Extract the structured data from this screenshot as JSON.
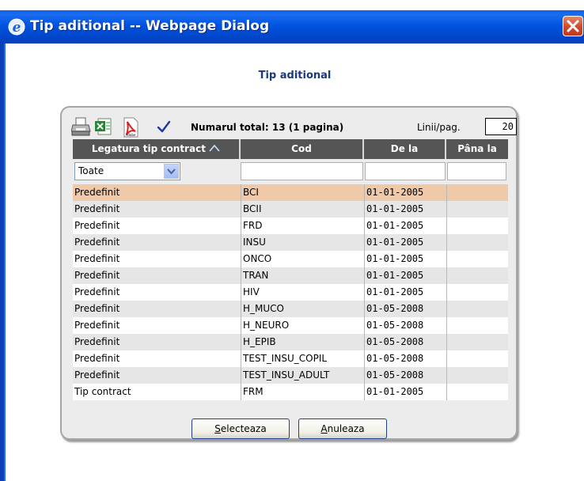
{
  "window": {
    "title": "Tip aditional -- Webpage Dialog",
    "title_icon": "ie-icon",
    "close_icon": "close-icon"
  },
  "dialog": {
    "heading": "Tip aditional"
  },
  "toolbar": {
    "icons": [
      "print-icon",
      "excel-icon",
      "pdf-icon",
      "checkmark-icon"
    ],
    "total_text": "Numarul total: 13 (1 pagina)",
    "lines_label": "Linii/pag.",
    "lines_value": "20"
  },
  "grid": {
    "columns": [
      "Legatura tip contract",
      "Cod",
      "De la",
      "Pâna la"
    ],
    "sort_indicator": "sort-up-icon",
    "filter": {
      "selected": "Toate"
    },
    "rows": [
      {
        "legatura": "Predefinit",
        "cod": "BCI",
        "de_la": "01-01-2005",
        "pana_la": ""
      },
      {
        "legatura": "Predefinit",
        "cod": "BCII",
        "de_la": "01-01-2005",
        "pana_la": ""
      },
      {
        "legatura": "Predefinit",
        "cod": "FRD",
        "de_la": "01-01-2005",
        "pana_la": ""
      },
      {
        "legatura": "Predefinit",
        "cod": "INSU",
        "de_la": "01-01-2005",
        "pana_la": ""
      },
      {
        "legatura": "Predefinit",
        "cod": "ONCO",
        "de_la": "01-01-2005",
        "pana_la": ""
      },
      {
        "legatura": "Predefinit",
        "cod": "TRAN",
        "de_la": "01-01-2005",
        "pana_la": ""
      },
      {
        "legatura": "Predefinit",
        "cod": "HIV",
        "de_la": "01-01-2005",
        "pana_la": ""
      },
      {
        "legatura": "Predefinit",
        "cod": "H_MUCO",
        "de_la": "01-05-2008",
        "pana_la": ""
      },
      {
        "legatura": "Predefinit",
        "cod": "H_NEURO",
        "de_la": "01-05-2008",
        "pana_la": ""
      },
      {
        "legatura": "Predefinit",
        "cod": "H_EPIB",
        "de_la": "01-05-2008",
        "pana_la": ""
      },
      {
        "legatura": "Predefinit",
        "cod": "TEST_INSU_COPIL",
        "de_la": "01-05-2008",
        "pana_la": ""
      },
      {
        "legatura": "Predefinit",
        "cod": "TEST_INSU_ADULT",
        "de_la": "01-05-2008",
        "pana_la": ""
      },
      {
        "legatura": "Tip contract",
        "cod": "FRM",
        "de_la": "01-01-2005",
        "pana_la": ""
      }
    ],
    "selected_row_index": 0
  },
  "buttons": {
    "select_mnemonic": "S",
    "select_rest": "electeaza",
    "cancel_mnemonic": "A",
    "cancel_rest": "nuleaza"
  },
  "colors": {
    "titlebar": "#0053e0",
    "selected_row": "#f0c9a8",
    "alt_row": "#e6e6e6",
    "header": "#555555",
    "heading_text": "#1a3a7a"
  }
}
